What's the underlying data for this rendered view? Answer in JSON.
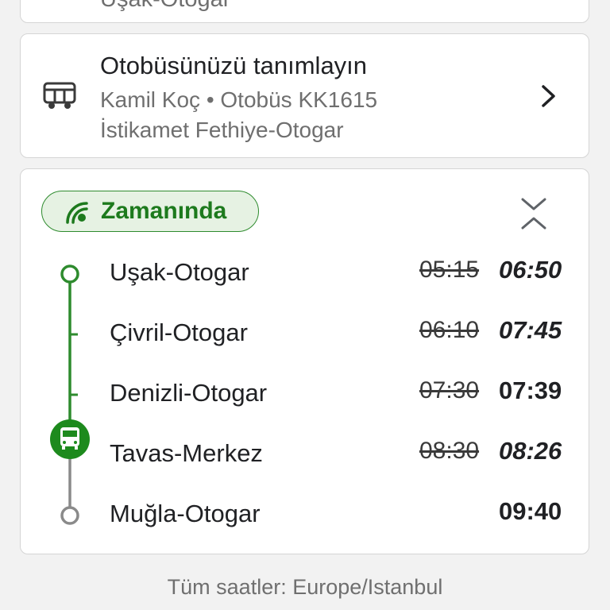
{
  "previous_card": {
    "partial_text": "Uşak-Otogar"
  },
  "bus_card": {
    "title": "Otobüsünüzü tanımlayın",
    "subtitle": "Kamil Koç • Otobüs KK1615",
    "destination": "İstikamet Fethiye-Otogar"
  },
  "status": {
    "label": "Zamanında",
    "color": "#1d7a1d"
  },
  "stops": [
    {
      "name": "Uşak-Otogar",
      "scheduled": "05:15",
      "actual": "06:50"
    },
    {
      "name": "Çivril-Otogar",
      "scheduled": "06:10",
      "actual": "07:45"
    },
    {
      "name": "Denizli-Otogar",
      "scheduled": "07:30",
      "actual": "07:39"
    },
    {
      "name": "Tavas-Merkez",
      "scheduled": "08:30",
      "actual": "08:26"
    },
    {
      "name": "Muğla-Otogar",
      "scheduled": "",
      "actual": "09:40"
    }
  ],
  "footer": {
    "timezone_note": "Tüm saatler: Europe/Istanbul"
  },
  "icons": {
    "bus": "bus-icon",
    "next": "chevron-right-icon",
    "signal": "live-signal-icon",
    "collapse": "collapse-icon",
    "current_position": "bus-position-icon"
  }
}
